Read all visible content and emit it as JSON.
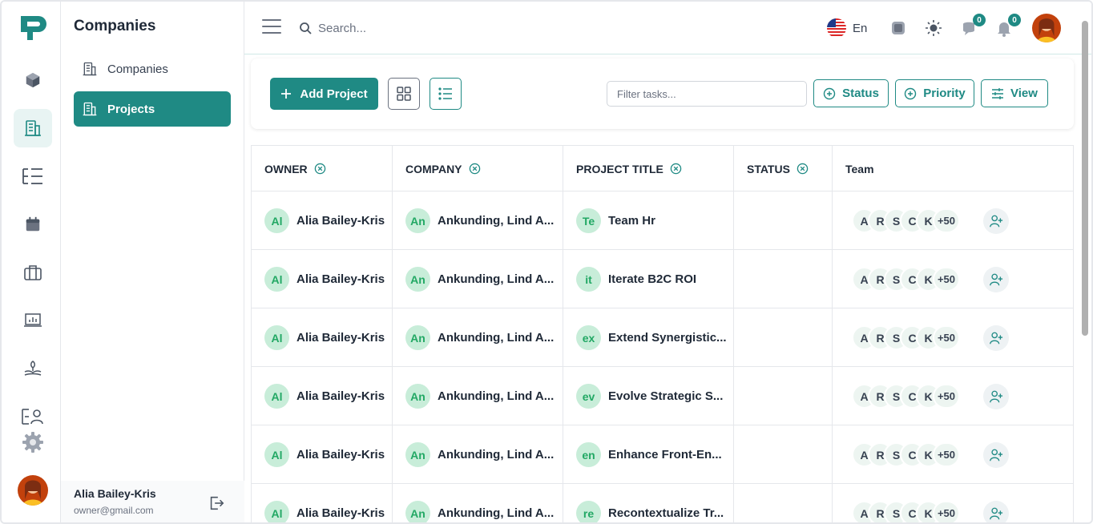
{
  "colors": {
    "accent": "#1f8a84",
    "chip_bg": "#c8edd9",
    "chip_text": "#22a864"
  },
  "sidebar": {
    "rail_icons": [
      "logo-icon",
      "cube-icon",
      "building-icon",
      "tree-list-icon",
      "calendar-icon",
      "briefcase-icon",
      "presentation-icon",
      "hand-plant-icon",
      "contacts-icon",
      "settings-icon"
    ],
    "title": "Companies",
    "items": [
      {
        "label": "Companies",
        "icon": "building-icon",
        "active": false
      },
      {
        "label": "Projects",
        "icon": "building-icon",
        "active": true
      }
    ],
    "user": {
      "name": "Alia Bailey-Kris",
      "email": "owner@gmail.com"
    }
  },
  "header": {
    "search_placeholder": "Search...",
    "language": "En",
    "messages_count": "0",
    "notifications_count": "0"
  },
  "toolbar": {
    "add_label": "Add Project",
    "filter_placeholder": "Filter tasks...",
    "status_label": "Status",
    "priority_label": "Priority",
    "view_label": "View"
  },
  "table": {
    "columns": [
      "OWNER",
      "COMPANY",
      "PROJECT TITLE",
      "STATUS",
      "Team"
    ],
    "rows": [
      {
        "owner_initials": "Al",
        "owner": "Alia Bailey-Kris",
        "company_initials": "An",
        "company": "Ankunding, Lind A...",
        "title_initials": "Te",
        "title": "Team Hr",
        "status": "",
        "team": [
          "A",
          "R",
          "S",
          "C",
          "K"
        ],
        "team_more": "+50"
      },
      {
        "owner_initials": "Al",
        "owner": "Alia Bailey-Kris",
        "company_initials": "An",
        "company": "Ankunding, Lind A...",
        "title_initials": "it",
        "title": "Iterate B2C ROI",
        "status": "",
        "team": [
          "A",
          "R",
          "S",
          "C",
          "K"
        ],
        "team_more": "+50"
      },
      {
        "owner_initials": "Al",
        "owner": "Alia Bailey-Kris",
        "company_initials": "An",
        "company": "Ankunding, Lind A...",
        "title_initials": "ex",
        "title": "Extend Synergistic...",
        "status": "",
        "team": [
          "A",
          "R",
          "S",
          "C",
          "K"
        ],
        "team_more": "+50"
      },
      {
        "owner_initials": "Al",
        "owner": "Alia Bailey-Kris",
        "company_initials": "An",
        "company": "Ankunding, Lind A...",
        "title_initials": "ev",
        "title": "Evolve Strategic S...",
        "status": "",
        "team": [
          "A",
          "R",
          "S",
          "C",
          "K"
        ],
        "team_more": "+50"
      },
      {
        "owner_initials": "Al",
        "owner": "Alia Bailey-Kris",
        "company_initials": "An",
        "company": "Ankunding, Lind A...",
        "title_initials": "en",
        "title": "Enhance Front-En...",
        "status": "",
        "team": [
          "A",
          "R",
          "S",
          "C",
          "K"
        ],
        "team_more": "+50"
      },
      {
        "owner_initials": "Al",
        "owner": "Alia Bailey-Kris",
        "company_initials": "An",
        "company": "Ankunding, Lind A...",
        "title_initials": "re",
        "title": "Recontextualize Tr...",
        "status": "",
        "team": [
          "A",
          "R",
          "S",
          "C",
          "K"
        ],
        "team_more": "+50"
      }
    ]
  }
}
